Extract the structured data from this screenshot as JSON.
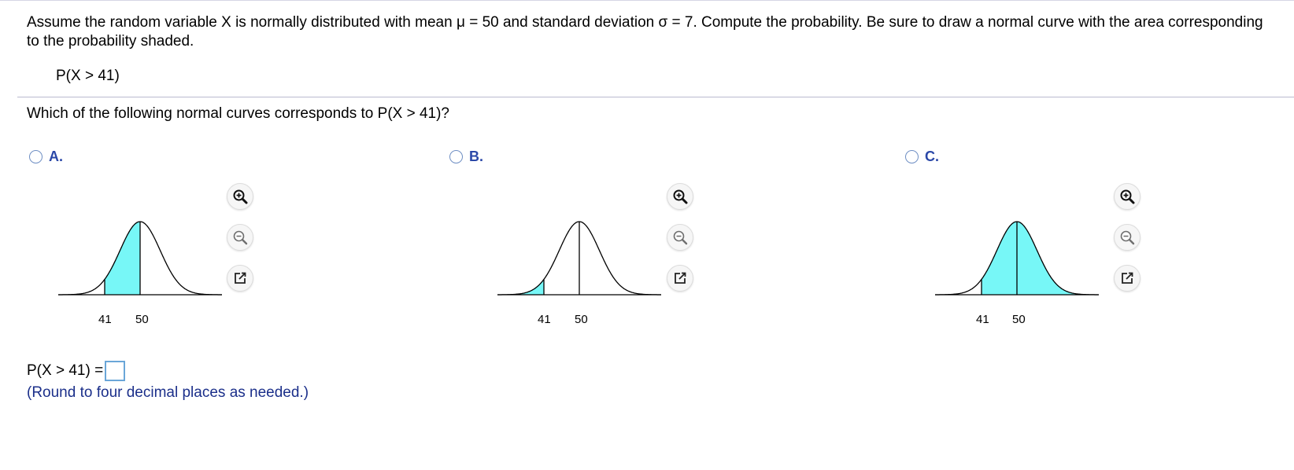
{
  "problem": {
    "text": "Assume the random variable X is normally distributed with mean μ = 50 and standard deviation σ = 7. Compute the probability. Be sure to draw a normal curve with the area corresponding to the probability shaded.",
    "expression": "P(X > 41)"
  },
  "question": "Which of the following normal curves corresponds to P(X > 41)?",
  "options": [
    {
      "letter": "A.",
      "shaded_region": "between 41 and 50",
      "tick_labels": [
        "41",
        "50"
      ]
    },
    {
      "letter": "B.",
      "shaded_region": "left of 41",
      "tick_labels": [
        "41",
        "50"
      ]
    },
    {
      "letter": "C.",
      "shaded_region": "right of 41",
      "tick_labels": [
        "41",
        "50"
      ]
    }
  ],
  "tools": {
    "zoom_in": "zoom-in-icon",
    "zoom_out": "zoom-out-icon",
    "popout": "popout-icon"
  },
  "answer": {
    "label": "P(X > 41) =",
    "value": "",
    "hint": "(Round to four decimal places as needed.)"
  },
  "colors": {
    "shade": "#77f7f7",
    "option_letter": "#2b48a8",
    "hint": "#1b2f8a",
    "answer_box_border": "#6aa6d8"
  }
}
